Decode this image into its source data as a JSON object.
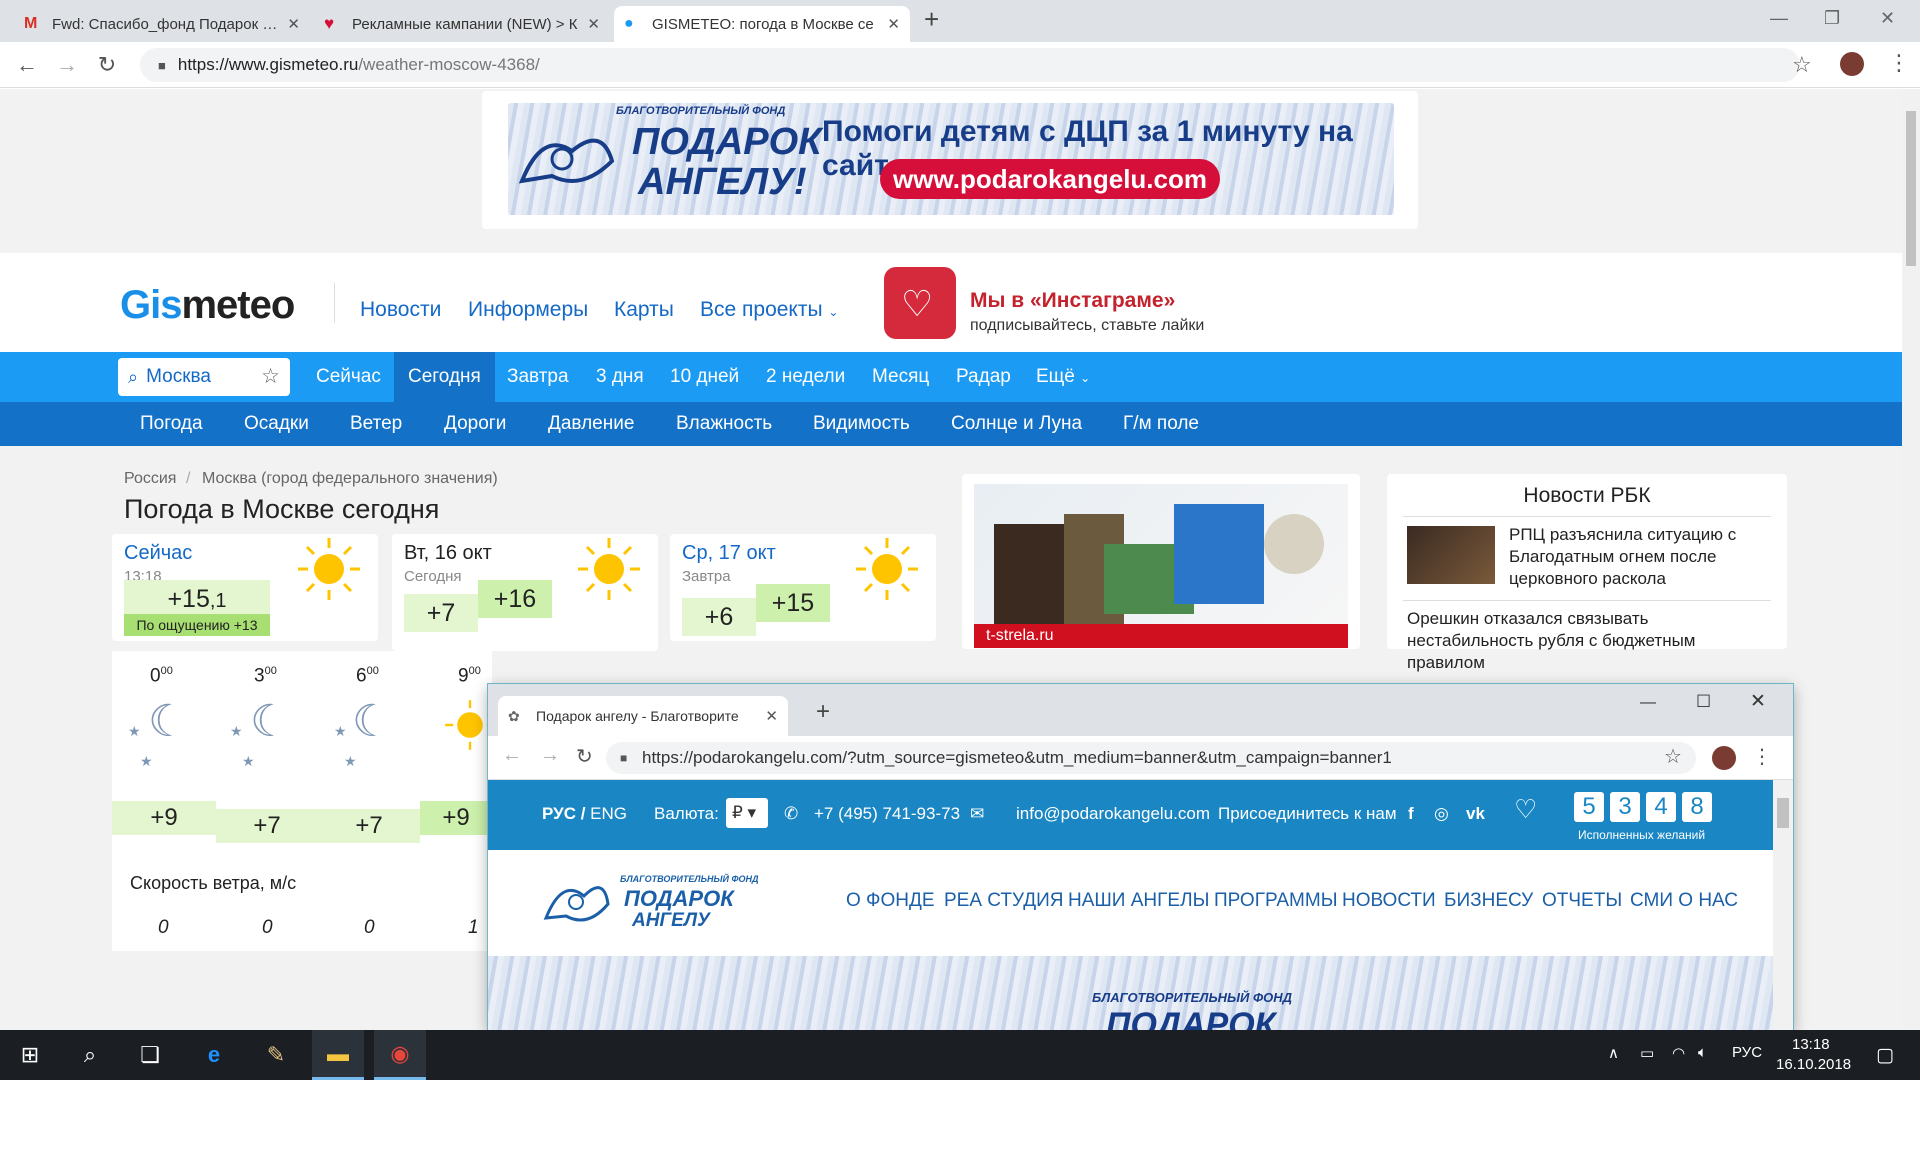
{
  "browser": {
    "tabs": [
      {
        "title": "Fwd: Спасибо_фонд Подарок Ан",
        "icon": "gmail-icon"
      },
      {
        "title": "Рекламные кампании (NEW) > К",
        "icon": "ads-icon"
      },
      {
        "title": "GISMETEO: погода в Москве се",
        "icon": "gismeteo-drop-icon"
      }
    ],
    "url_host": "https://www.gismeteo.ru",
    "url_path": "/weather-moscow-4368/"
  },
  "banner": {
    "org_small": "БЛАГОТВОРИТЕЛЬНЫЙ ФОНД",
    "org_line1": "ПОДАРОК",
    "org_line2": "АНГЕЛУ!",
    "tagline": "Помоги детям с ДЦП за 1 минуту на сайте",
    "url": "www.podarokangelu.com"
  },
  "header": {
    "logo_a": "Gis",
    "logo_b": "meteo",
    "nav": [
      "Новости",
      "Информеры",
      "Карты",
      "Все проекты"
    ],
    "insta_title": "Мы в «Инстаграме»",
    "insta_sub": "подписывайтесь, ставьте лайки"
  },
  "search": {
    "value": "Москва"
  },
  "nav1": [
    "Сейчас",
    "Сегодня",
    "Завтра",
    "3 дня",
    "10 дней",
    "2 недели",
    "Месяц",
    "Радар",
    "Ещё"
  ],
  "nav2": [
    "Погода",
    "Осадки",
    "Ветер",
    "Дороги",
    "Давление",
    "Влажность",
    "Видимость",
    "Солнце и Луна",
    "Г/м поле"
  ],
  "breadcrumb": [
    "Россия",
    "/",
    "Москва (город федерального значения)"
  ],
  "title": "Погода в Москве  сегодня",
  "cards": {
    "now": {
      "title": "Сейчас",
      "time": "13:18",
      "temp_main": "+15",
      "temp_dec": ",1",
      "feels": "По ощущению +13"
    },
    "today": {
      "title": "Вт, 16 окт",
      "sub": "Сегодня",
      "low": "+7",
      "high": "+16"
    },
    "tomorrow": {
      "title": "Ср, 17 окт",
      "sub": "Завтра",
      "low": "+6",
      "high": "+15"
    }
  },
  "hourly": {
    "hours": [
      {
        "h": "0",
        "m": "00"
      },
      {
        "h": "3",
        "m": "00"
      },
      {
        "h": "6",
        "m": "00"
      },
      {
        "h": "9",
        "m": "00"
      }
    ],
    "temps": [
      "+9",
      "+7",
      "+7",
      "+9"
    ],
    "wind_label": "Скорость ветра, м/с",
    "wind": [
      "0",
      "0",
      "0",
      "1"
    ]
  },
  "ad": {
    "label": "t-strela.ru"
  },
  "rbk": {
    "title": "Новости РБК",
    "items": [
      "РПЦ разъяснила ситуацию с Благодатным огнем после церковного раскола",
      "Орешкин отказался связывать нестабильность рубля с бюджетным правилом"
    ]
  },
  "popup": {
    "tab_title": "Подарок ангелу - Благотворите",
    "url": "https://podarokangelu.com/?utm_source=gismeteo&utm_medium=banner&utm_campaign=banner1",
    "lang_ru": "РУС",
    "lang_sep": " / ",
    "lang_en": "ENG",
    "currency_label": "Валюта:",
    "currency_value": "₽",
    "phone": "+7 (495) 741-93-73",
    "email": "info@podarokangelu.com",
    "join": "Присоединитесь к нам",
    "counter": [
      "5",
      "3",
      "4",
      "8"
    ],
    "counter_label": "Исполненных желаний",
    "logo_small": "БЛАГОТВОРИТЕЛЬНЫЙ ФОНД",
    "logo_l1": "ПОДАРОК",
    "logo_l2": "АНГЕЛУ",
    "nav": [
      "О ФОНДЕ",
      "РЕА СТУДИЯ",
      "НАШИ АНГЕЛЫ",
      "ПРОГРАММЫ",
      "НОВОСТИ",
      "БИЗНЕСУ",
      "ОТЧЕТЫ",
      "СМИ О НАС"
    ],
    "banner_small": "БЛАГОТВОРИТЕЛЬНЫЙ ФОНД",
    "banner_big": "ПОДАРОК"
  },
  "taskbar": {
    "lang": "РУС",
    "time": "13:18",
    "date": "16.10.2018"
  },
  "colors": {
    "gismeteo_blue": "#1b9bf3",
    "gismeteo_dark": "#1372c8",
    "temp_green": "#e3f6cf",
    "popup_blue": "#1a87c4",
    "brand_red": "#d60f3a"
  }
}
